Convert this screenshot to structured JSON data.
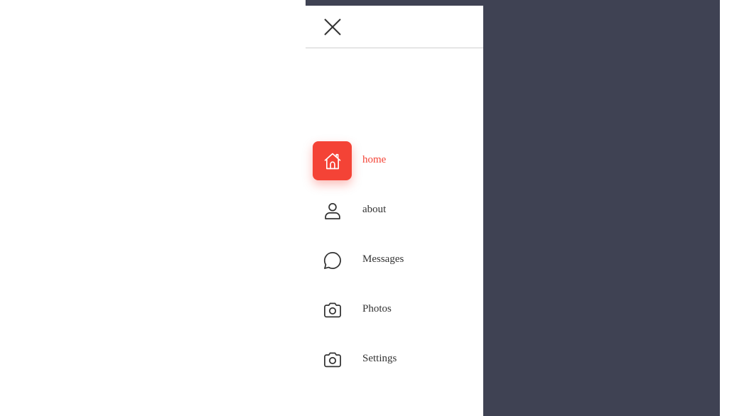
{
  "colors": {
    "accent": "#f44336",
    "overlay": "#3f4253",
    "text": "#333333"
  },
  "drawer": {
    "close_icon": "close-icon",
    "nav": [
      {
        "label": "home",
        "icon": "home-icon",
        "active": true
      },
      {
        "label": "about",
        "icon": "user-icon",
        "active": false
      },
      {
        "label": "Messages",
        "icon": "chat-bubble-icon",
        "active": false
      },
      {
        "label": "Photos",
        "icon": "camera-icon",
        "active": false
      },
      {
        "label": "Settings",
        "icon": "camera-icon",
        "active": false
      }
    ]
  }
}
